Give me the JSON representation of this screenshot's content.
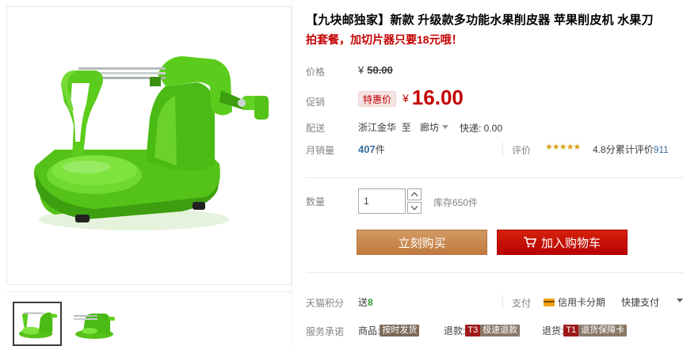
{
  "product": {
    "title": "【九块邮独家】新款 升级款多功能水果削皮器 苹果削皮机 水果刀",
    "subtitle": "拍套餐，加切片器只要18元哦！"
  },
  "price": {
    "label": "价格",
    "currency": "¥",
    "original": "50.00"
  },
  "promo": {
    "label": "促销",
    "tag": "特惠价",
    "currency": "¥",
    "price": "16.00"
  },
  "shipping": {
    "label": "配送",
    "from": "浙江金华",
    "to_prefix": "至",
    "to": "廊坊",
    "fee": "快递: 0.00"
  },
  "sales": {
    "label": "月销量",
    "count": "407",
    "unit": "件",
    "review_label": "评价",
    "stars": "★★★★★",
    "score": "4.8分",
    "review_text": "累计评价",
    "review_count": "911"
  },
  "quantity": {
    "label": "数量",
    "value": "1",
    "stock": "库存650件"
  },
  "buttons": {
    "buy": "立刻购买",
    "cart": "加入购物车"
  },
  "points": {
    "label": "天猫积分",
    "prefix": "送",
    "value": "8",
    "pay_label": "支付",
    "card": "信用卡分期",
    "fast": "快捷支付"
  },
  "service": {
    "label": "服务承诺",
    "items": [
      {
        "prefix": "商品:",
        "badge": "按时发货"
      },
      {
        "prefix": "退款:",
        "badge_code": "T3",
        "badge": "极速退款"
      },
      {
        "prefix": "退货:",
        "badge_code": "T1",
        "badge": "退货保障卡"
      }
    ]
  },
  "colors": {
    "accent_red": "#c40000",
    "product_green": "#5ccd1e",
    "buy_button": "#c8884d",
    "cart_button": "#c40000"
  }
}
